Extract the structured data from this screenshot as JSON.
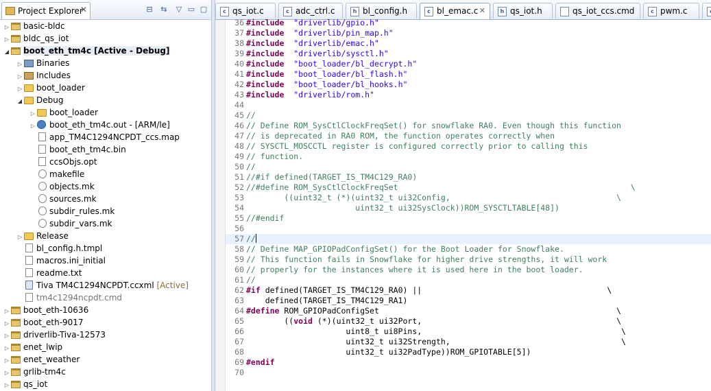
{
  "explorer": {
    "title": "Project Explorer",
    "close": "✕",
    "toolbar": {
      "collapse": "⊟",
      "link": "⇆",
      "menu": "▽",
      "minimize": "▭",
      "maximize": "▢"
    },
    "items": [
      {
        "label": "basic-bldc",
        "icon": "project-icon",
        "indent": 0,
        "arrow": "▷"
      },
      {
        "label": "bldc_qs_iot",
        "icon": "project-icon",
        "indent": 0,
        "arrow": "▷"
      },
      {
        "label": "boot_eth_tm4c  [Active - Debug]",
        "icon": "project-icon",
        "indent": 0,
        "arrow": "◢",
        "bold": true,
        "selected": true
      },
      {
        "label": "Binaries",
        "icon": "binaries-icon",
        "indent": 1,
        "arrow": "▷"
      },
      {
        "label": "Includes",
        "icon": "includes-icon",
        "indent": 1,
        "arrow": "▷"
      },
      {
        "label": "boot_loader",
        "icon": "folder-icon",
        "indent": 1,
        "arrow": "▷"
      },
      {
        "label": "Debug",
        "icon": "folder-icon",
        "indent": 1,
        "arrow": "◢"
      },
      {
        "label": "boot_loader",
        "icon": "folder-icon",
        "indent": 2,
        "arrow": "▷"
      },
      {
        "label": "boot_eth_tm4c.out - [ARM/le]",
        "icon": "executable-icon",
        "indent": 2,
        "arrow": "▷"
      },
      {
        "label": "app_TM4C1294NCPDT_ccs.map",
        "icon": "file-icon",
        "indent": 2,
        "arrow": ""
      },
      {
        "label": "boot_eth_tm4c.bin",
        "icon": "file-icon",
        "indent": 2,
        "arrow": ""
      },
      {
        "label": "ccsObjs.opt",
        "icon": "file-icon",
        "indent": 2,
        "arrow": ""
      },
      {
        "label": "makefile",
        "icon": "makefile-icon",
        "indent": 2,
        "arrow": ""
      },
      {
        "label": "objects.mk",
        "icon": "makefile-icon",
        "indent": 2,
        "arrow": ""
      },
      {
        "label": "sources.mk",
        "icon": "makefile-icon",
        "indent": 2,
        "arrow": ""
      },
      {
        "label": "subdir_rules.mk",
        "icon": "makefile-icon",
        "indent": 2,
        "arrow": ""
      },
      {
        "label": "subdir_vars.mk",
        "icon": "makefile-icon",
        "indent": 2,
        "arrow": ""
      },
      {
        "label": "Release",
        "icon": "folder-icon",
        "indent": 1,
        "arrow": "▷"
      },
      {
        "label": "bl_config.h.tmpl",
        "icon": "file-icon",
        "indent": 1,
        "arrow": ""
      },
      {
        "label": "macros.ini_initial",
        "icon": "file-icon",
        "indent": 1,
        "arrow": ""
      },
      {
        "label": "readme.txt",
        "icon": "file-icon",
        "indent": 1,
        "arrow": ""
      },
      {
        "label": "Tiva TM4C1294NCPDT.ccxml",
        "icon": "ccxml-icon",
        "indent": 1,
        "arrow": "",
        "suffix": " [Active]"
      },
      {
        "label": "tm4c1294ncpdt.cmd",
        "icon": "file-icon",
        "indent": 1,
        "arrow": "",
        "dimmed": true
      },
      {
        "label": "boot_eth-10636",
        "icon": "project-icon",
        "indent": 0,
        "arrow": "▷"
      },
      {
        "label": "boot_eth-9017",
        "icon": "project-icon",
        "indent": 0,
        "arrow": "▷"
      },
      {
        "label": "driverlib-Tiva-12573",
        "icon": "project-icon",
        "indent": 0,
        "arrow": "▷"
      },
      {
        "label": "enet_lwip",
        "icon": "project-icon",
        "indent": 0,
        "arrow": "▷"
      },
      {
        "label": "enet_weather",
        "icon": "project-icon",
        "indent": 0,
        "arrow": "▷"
      },
      {
        "label": "grlib-tm4c",
        "icon": "project-icon",
        "indent": 0,
        "arrow": "▷"
      },
      {
        "label": "qs_iot",
        "icon": "project-icon",
        "indent": 0,
        "arrow": "▷"
      }
    ]
  },
  "editor": {
    "tabs": [
      {
        "label": "qs_iot.c",
        "icon": "c",
        "active": false
      },
      {
        "label": "adc_ctrl.c",
        "icon": "c",
        "active": false
      },
      {
        "label": "bl_config.h",
        "icon": "h",
        "active": false
      },
      {
        "label": "bl_emac.c",
        "icon": "c",
        "active": true,
        "close": "✕"
      },
      {
        "label": "qs_iot.h",
        "icon": "h",
        "active": false
      },
      {
        "label": "qs_iot_ccs.cmd",
        "icon": "cmd",
        "active": false
      },
      {
        "label": "pwm.c",
        "icon": "c",
        "active": false
      },
      {
        "label": "",
        "icon": "c",
        "active": false
      }
    ],
    "current_line": 57,
    "lines": [
      {
        "n": "36",
        "seg": [
          [
            "kw",
            "#include"
          ],
          [
            "",
            "  "
          ],
          [
            "str",
            "\"driverlib/gpio.h\""
          ]
        ]
      },
      {
        "n": "37",
        "seg": [
          [
            "kw",
            "#include"
          ],
          [
            "",
            "  "
          ],
          [
            "str",
            "\"driverlib/pin_map.h\""
          ]
        ]
      },
      {
        "n": "38",
        "seg": [
          [
            "kw",
            "#include"
          ],
          [
            "",
            "  "
          ],
          [
            "str",
            "\"driverlib/emac.h\""
          ]
        ]
      },
      {
        "n": "39",
        "seg": [
          [
            "kw",
            "#include"
          ],
          [
            "",
            "  "
          ],
          [
            "str",
            "\"driverlib/sysctl.h\""
          ]
        ]
      },
      {
        "n": "40",
        "seg": [
          [
            "kw",
            "#include"
          ],
          [
            "",
            "  "
          ],
          [
            "str",
            "\"boot_loader/bl_decrypt.h\""
          ]
        ]
      },
      {
        "n": "41",
        "seg": [
          [
            "kw",
            "#include"
          ],
          [
            "",
            "  "
          ],
          [
            "str",
            "\"boot_loader/bl_flash.h\""
          ]
        ]
      },
      {
        "n": "42",
        "seg": [
          [
            "kw",
            "#include"
          ],
          [
            "",
            "  "
          ],
          [
            "str",
            "\"boot_loader/bl_hooks.h\""
          ]
        ]
      },
      {
        "n": "43",
        "seg": [
          [
            "kw",
            "#include"
          ],
          [
            "",
            "  "
          ],
          [
            "str",
            "\"driverlib/rom.h\""
          ]
        ]
      },
      {
        "n": "44",
        "seg": []
      },
      {
        "n": "45",
        "seg": [
          [
            "cmt",
            "//"
          ]
        ]
      },
      {
        "n": "46",
        "seg": [
          [
            "cmt",
            "// Define ROM_SysCtlClockFreqSet() for snowflake RA0. Even though this function"
          ]
        ]
      },
      {
        "n": "47",
        "seg": [
          [
            "cmt",
            "// is deprecated in RA0 ROM, the function operates correctly when"
          ]
        ]
      },
      {
        "n": "48",
        "seg": [
          [
            "cmt",
            "// SYSCTL_MOSCCTL register is configured correctly prior to calling this"
          ]
        ]
      },
      {
        "n": "49",
        "seg": [
          [
            "cmt",
            "// function."
          ]
        ]
      },
      {
        "n": "50",
        "seg": [
          [
            "cmt",
            "//"
          ]
        ]
      },
      {
        "n": "51",
        "seg": [
          [
            "cmt",
            "//#if defined(TARGET_IS_TM4C129_RA0)"
          ]
        ]
      },
      {
        "n": "52",
        "seg": [
          [
            "cmt",
            "//#define ROM_SysCtlClockFreqSet                                                 \\"
          ]
        ]
      },
      {
        "n": "53",
        "seg": [
          [
            "cmt",
            "        ((uint32_t (*)(uint32_t ui32Config,                                   \\"
          ]
        ]
      },
      {
        "n": "54",
        "seg": [
          [
            "cmt",
            "                       uint32_t ui32SysClock))ROM_SYSCTLTABLE[48])"
          ]
        ]
      },
      {
        "n": "55",
        "seg": [
          [
            "cmt",
            "//#endif"
          ]
        ]
      },
      {
        "n": "56",
        "seg": []
      },
      {
        "n": "57",
        "seg": [
          [
            "cmt",
            "//"
          ]
        ],
        "caret": true
      },
      {
        "n": "58",
        "seg": [
          [
            "cmt",
            "// Define MAP_GPIOPadConfigSet() for the Boot Loader for Snowflake."
          ]
        ]
      },
      {
        "n": "59",
        "seg": [
          [
            "cmt",
            "// This function fails in Snowflake for higher drive strengths, it will work"
          ]
        ]
      },
      {
        "n": "60",
        "seg": [
          [
            "cmt",
            "// properly for the instances where it is used here in the boot loader."
          ]
        ]
      },
      {
        "n": "61",
        "seg": [
          [
            "cmt",
            "//"
          ]
        ]
      },
      {
        "n": "62",
        "seg": [
          [
            "kw",
            "#if"
          ],
          [
            "",
            " defined(TARGET_IS_TM4C129_RA0) ||                                       \\"
          ]
        ]
      },
      {
        "n": "63",
        "seg": [
          [
            "",
            "    defined(TARGET_IS_TM4C129_RA1)"
          ]
        ]
      },
      {
        "n": "64",
        "seg": [
          [
            "kw",
            "#define"
          ],
          [
            "",
            " ROM_GPIOPadConfigSet                                                  \\"
          ]
        ]
      },
      {
        "n": "65",
        "seg": [
          [
            "",
            "        (("
          ],
          [
            "kw",
            "void"
          ],
          [
            "",
            " (*)(uint32_t ui32Port,                                         \\"
          ]
        ]
      },
      {
        "n": "66",
        "seg": [
          [
            "",
            "                     uint8_t ui8Pins,                                          \\"
          ]
        ]
      },
      {
        "n": "67",
        "seg": [
          [
            "",
            "                     uint32_t ui32Strength,                                    \\"
          ]
        ]
      },
      {
        "n": "68",
        "seg": [
          [
            "",
            "                     uint32_t ui32PadType))ROM_GPIOTABLE[5])"
          ]
        ]
      },
      {
        "n": "69",
        "seg": [
          [
            "kw",
            "#endif"
          ]
        ]
      },
      {
        "n": "70",
        "seg": []
      }
    ]
  }
}
